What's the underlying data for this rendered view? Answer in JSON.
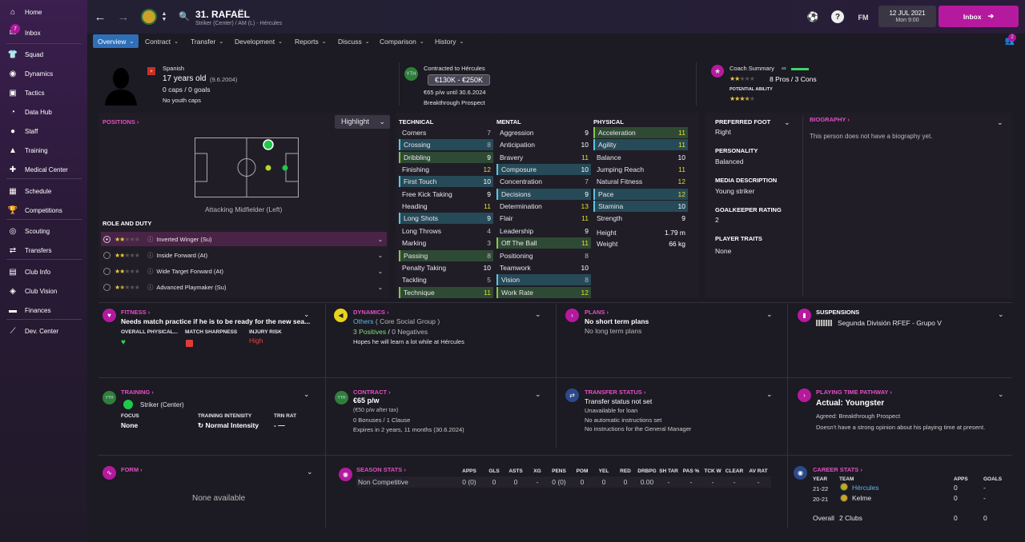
{
  "sidebar": {
    "items": [
      {
        "label": "Home",
        "icon": "home-icon"
      },
      {
        "label": "Inbox",
        "icon": "inbox-icon",
        "badge": "7"
      },
      {
        "label": "Squad",
        "icon": "squad-icon"
      },
      {
        "label": "Dynamics",
        "icon": "dynamics-icon"
      },
      {
        "label": "Tactics",
        "icon": "tactics-icon"
      },
      {
        "label": "Data Hub",
        "icon": "data-hub-icon"
      },
      {
        "label": "Staff",
        "icon": "staff-icon"
      },
      {
        "label": "Training",
        "icon": "training-icon"
      },
      {
        "label": "Medical Center",
        "icon": "medical-icon"
      },
      {
        "label": "Schedule",
        "icon": "schedule-icon"
      },
      {
        "label": "Competitions",
        "icon": "trophy-icon"
      },
      {
        "label": "Scouting",
        "icon": "scouting-icon"
      },
      {
        "label": "Transfers",
        "icon": "transfers-icon"
      },
      {
        "label": "Club Info",
        "icon": "club-info-icon"
      },
      {
        "label": "Club Vision",
        "icon": "club-vision-icon"
      },
      {
        "label": "Finances",
        "icon": "finances-icon"
      },
      {
        "label": "Dev. Center",
        "icon": "dev-center-icon"
      }
    ]
  },
  "header": {
    "title": "31. RAFAËL",
    "subtitle": "Striker (Center) / AM (L) - Hércules",
    "fm": "FM",
    "date": "12 JUL 2021",
    "time": "Mon 9:00",
    "inbox": "Inbox",
    "notif": "2"
  },
  "nav": [
    {
      "label": "Overview"
    },
    {
      "label": "Contract"
    },
    {
      "label": "Transfer"
    },
    {
      "label": "Development"
    },
    {
      "label": "Reports"
    },
    {
      "label": "Discuss"
    },
    {
      "label": "Comparison"
    },
    {
      "label": "History"
    }
  ],
  "profile": {
    "nationality": "Spanish",
    "age": "17 years old",
    "dob": "(9.6.2004)",
    "caps": "0 caps / 0 goals",
    "youth": "No youth caps",
    "contract_title": "Contracted to Hércules",
    "value": "€130K - €250K",
    "wage": "€65 p/w until 30.6.2024",
    "prospect": "Breakthrough Prospect",
    "coach_summary": "Coach Summary",
    "coach_pros": "8 Pros / 3 Cons",
    "potential_label": "Potential Ability"
  },
  "positions": {
    "title": "Positions",
    "highlight": "Highlight",
    "pos_label": "Attacking Midfielder (Left)",
    "role_title": "Role and Duty",
    "roles": [
      {
        "name": "Inverted Winger (Su)",
        "stars": 2
      },
      {
        "name": "Inside Forward (At)",
        "stars": 2
      },
      {
        "name": "Wide Target Forward (At)",
        "stars": 2
      },
      {
        "name": "Advanced Playmaker (Su)",
        "stars": 1.5
      }
    ]
  },
  "attributes": {
    "technical_title": "Technical",
    "mental_title": "Mental",
    "physical_title": "Physical",
    "technical": [
      [
        "Corners",
        "7"
      ],
      [
        "Crossing",
        "8"
      ],
      [
        "Dribbling",
        "9"
      ],
      [
        "Finishing",
        "12"
      ],
      [
        "First Touch",
        "10"
      ],
      [
        "Free Kick Taking",
        "9"
      ],
      [
        "Heading",
        "11"
      ],
      [
        "Long Shots",
        "9"
      ],
      [
        "Long Throws",
        "4"
      ],
      [
        "Marking",
        "3"
      ],
      [
        "Passing",
        "8"
      ],
      [
        "Penalty Taking",
        "10"
      ],
      [
        "Tackling",
        "5"
      ],
      [
        "Technique",
        "11"
      ]
    ],
    "mental": [
      [
        "Aggression",
        "9"
      ],
      [
        "Anticipation",
        "10"
      ],
      [
        "Bravery",
        "11"
      ],
      [
        "Composure",
        "10"
      ],
      [
        "Concentration",
        "7"
      ],
      [
        "Decisions",
        "9"
      ],
      [
        "Determination",
        "13"
      ],
      [
        "Flair",
        "11"
      ],
      [
        "Leadership",
        "9"
      ],
      [
        "Off The Ball",
        "11"
      ],
      [
        "Positioning",
        "8"
      ],
      [
        "Teamwork",
        "10"
      ],
      [
        "Vision",
        "8"
      ],
      [
        "Work Rate",
        "12"
      ]
    ],
    "physical": [
      [
        "Acceleration",
        "11"
      ],
      [
        "Agility",
        "11"
      ],
      [
        "Balance",
        "10"
      ],
      [
        "Jumping Reach",
        "11"
      ],
      [
        "Natural Fitness",
        "12"
      ],
      [
        "Pace",
        "12"
      ],
      [
        "Stamina",
        "10"
      ],
      [
        "Strength",
        "9"
      ]
    ],
    "height_label": "Height",
    "height": "1.79 m",
    "weight_label": "Weight",
    "weight": "66 kg"
  },
  "info": {
    "foot_label": "Preferred Foot",
    "foot": "Right",
    "personality_label": "Personality",
    "personality": "Balanced",
    "media_label": "Media Description",
    "media": "Young striker",
    "gk_label": "Goalkeeper Rating",
    "gk": "2",
    "traits_label": "Player Traits",
    "traits": "None",
    "bio_label": "Biography",
    "bio": "This person does not have a biography yet."
  },
  "fitness": {
    "title": "Fitness",
    "text": "Needs match practice if he is to be ready for the new sea...",
    "c1": "Overall Physical...",
    "c2": "Match Sharpness",
    "c3": "Injury Risk",
    "risk": "High"
  },
  "dynamics": {
    "title": "Dynamics",
    "group": "Others",
    "group2": "( Core Social Group )",
    "pos": "3 Positives",
    "sep": "/",
    "neg": "0 Negatives",
    "text": "Hopes he will learn a lot while at Hércules"
  },
  "plans": {
    "title": "Plans",
    "l1": "No short term plans",
    "l2": "No long term plans"
  },
  "suspensions": {
    "title": "Suspensions",
    "league": "Segunda División RFEF - Grupo V"
  },
  "training": {
    "title": "Training",
    "pos": "Striker (Center)",
    "focus_label": "Focus",
    "focus": "None",
    "intensity_label": "Training Intensity",
    "intensity": "Normal Intensity",
    "rat_label": "Trn Rat",
    "rat": "-"
  },
  "contract": {
    "title": "Contract",
    "wage": "€65 p/w",
    "after_tax": "(€50 p/w after tax)",
    "bonuses": "0 Bonuses / 1 Clause",
    "expires": "Expires in 2 years, 11 months  (30.6.2024)"
  },
  "transfer": {
    "title": "Transfer Status",
    "l1": "Transfer status not set",
    "l2": "Unavailable for loan",
    "l3": "No automatic instructions set",
    "l4": "No instructions for the General Manager"
  },
  "playing": {
    "title": "Playing Time Pathway",
    "actual": "Actual: Youngster",
    "agreed": "Agreed:  Breakthrough Prospect",
    "text": "Doesn't have a strong opinion about his playing time at present."
  },
  "form": {
    "title": "Form",
    "none": "None available"
  },
  "season": {
    "title": "Season Stats",
    "cols": [
      "APPS",
      "GLS",
      "ASTS",
      "XG",
      "PENS",
      "POM",
      "YEL",
      "RED",
      "DRBPG",
      "SH TAR",
      "PAS %",
      "TCK W",
      "CLEAR",
      "AV RAT"
    ],
    "row_label": "Non Competitive",
    "row": [
      "0 (0)",
      "0",
      "0",
      "-",
      "0 (0)",
      "0",
      "0",
      "0",
      "0.00",
      "-",
      "-",
      "-",
      "-",
      "-"
    ]
  },
  "career": {
    "title": "Career Stats",
    "c_year": "YEAR",
    "c_team": "TEAM",
    "c_apps": "APPS",
    "c_goals": "GOALS",
    "rows": [
      [
        "21-22",
        "Hércules",
        "0",
        "-"
      ],
      [
        "20-21",
        "Kelme",
        "0",
        "-"
      ]
    ],
    "overall_label": "Overall",
    "overall_clubs": "2 Clubs",
    "overall_apps": "0",
    "overall_goals": "0"
  }
}
